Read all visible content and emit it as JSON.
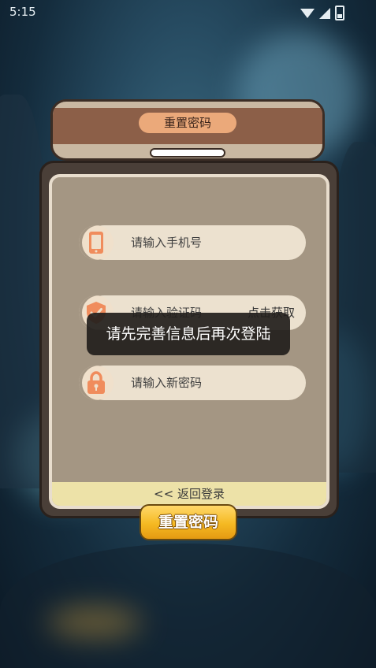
{
  "status_bar": {
    "time": "5:15",
    "icons": [
      "wifi-icon",
      "signal-icon",
      "battery-icon"
    ]
  },
  "header": {
    "title": "重置密码"
  },
  "form": {
    "phone": {
      "placeholder": "请输入手机号",
      "icon": "phone-icon"
    },
    "code": {
      "placeholder": "请输入验证码",
      "icon": "shield-check-icon",
      "get_code_label": "点击获取"
    },
    "new_password": {
      "placeholder": "请输入新密码",
      "icon": "lock-icon"
    },
    "back_link": "<< 返回登录"
  },
  "submit_label": "重置密码",
  "toast": {
    "message": "请先完善信息后再次登陆"
  },
  "colors": {
    "accent": "#eba97a",
    "button": "#f5b922",
    "card": "#a49683",
    "header_band": "#8c5f48"
  }
}
